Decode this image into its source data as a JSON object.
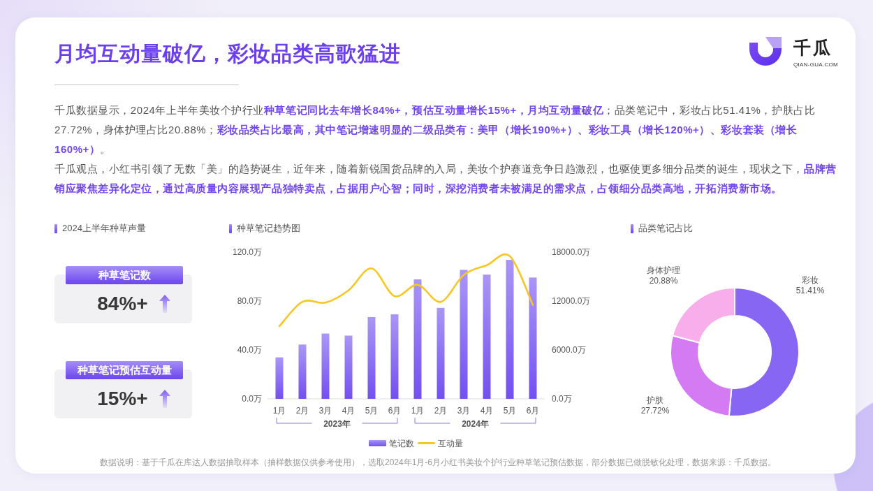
{
  "header": {
    "title": "月均互动量破亿，彩妆品类高歌猛进",
    "logo": {
      "name": "千瓜",
      "url": "QIAN-GUA.COM"
    }
  },
  "paragraphs": [
    "千瓜数据显示，2024年上半年美妆个护行业**种草笔记同比去年增长84%+，预估互动量增长15%+，月均互动量破亿**；品类笔记中，彩妆占比51.41%，护肤占比27.72%，身体护理占比20.88%；**彩妆品类占比最高，其中笔记增速明显的二级品类有：美甲（增长190%+）、彩妆工具（增长120%+）、彩妆套装（增长160%+）**。",
    "千瓜观点，小红书引领了无数「美」的趋势诞生，近年来，随着新锐国货品牌的入局，美妆个护赛道竞争日趋激烈，也驱使更多细分品类的诞生，现状之下，**品牌营销应聚焦差异化定位，通过高质量内容展现产品独特卖点，占据用户心智；同时，深挖消费者未被满足的需求点，占领细分品类高地，开拓消费新市场。**"
  ],
  "volume_panel": {
    "title": "2024上半年种草声量",
    "metrics": [
      {
        "label": "种草笔记数",
        "value": "84%+",
        "rising": true
      },
      {
        "label": "种草笔记预估互动量",
        "value": "15%+",
        "rising": true
      }
    ]
  },
  "trend_chart": {
    "title": "种草笔记趋势图",
    "notes": {
      "chart_data": {
        "type": "bar",
        "categories": [
          "1月",
          "2月",
          "3月",
          "4月",
          "5月",
          "6月",
          "1月",
          "2月",
          "3月",
          "4月",
          "5月",
          "6月"
        ],
        "series": [
          {
            "name": "笔记数",
            "color": "#7250f0",
            "values": [
              33.9,
              44.4,
              53.4,
              51.7,
              66.9,
              69.1,
              97.7,
              74.4,
              105.5,
              101.6,
              113.7,
              99.2
            ]
          }
        ],
        "ylim": [
          0,
          120
        ],
        "yticks": [
          {
            "value": 0,
            "label": "0.0万"
          },
          {
            "value": 40,
            "label": "40.0万"
          },
          {
            "value": 80,
            "label": "80.0万"
          },
          {
            "value": 120,
            "label": "120.0万"
          }
        ],
        "annotations": [
          {
            "text": "2023年"
          },
          {
            "text": "2024年"
          }
        ],
        "legend": "bottom"
      }
    },
    "interactions": {
      "chart_data": {
        "type": "line",
        "series": [
          {
            "name": "互动量",
            "color": "#f6c623",
            "values": [
              8900,
              11900,
              11800,
              13300,
              16000,
              12600,
              14000,
              11900,
              15200,
              16400,
              17500,
              11500
            ]
          }
        ],
        "ylim": [
          0,
          18000
        ],
        "yticks": [
          {
            "value": 0,
            "label": "0.0万"
          },
          {
            "value": 6000,
            "label": "6000.0万"
          },
          {
            "value": 12000,
            "label": "12000.0万"
          },
          {
            "value": 18000,
            "label": "18000.0万"
          }
        ],
        "legend": "bottom"
      }
    }
  },
  "category_chart": {
    "title": "品类笔记占比",
    "chart_data": {
      "type": "donut",
      "categories": [
        "彩妆",
        "护肤",
        "身体护理"
      ],
      "values": [
        51.41,
        27.72,
        20.88
      ],
      "colors": [
        "#8866f4",
        "#d47bf4",
        "#f8aeea"
      ],
      "value_labels": [
        "51.41%",
        "27.72%",
        "20.88%"
      ]
    }
  },
  "footnote": "数据说明：基于千瓜在库达人数据抽取样本（抽样数据仅供参考使用），选取2024年1月-6月小红书美妆个护行业种草笔记预估数据，部分数据已做脱敏化处理，数据来源：千瓜数据。"
}
